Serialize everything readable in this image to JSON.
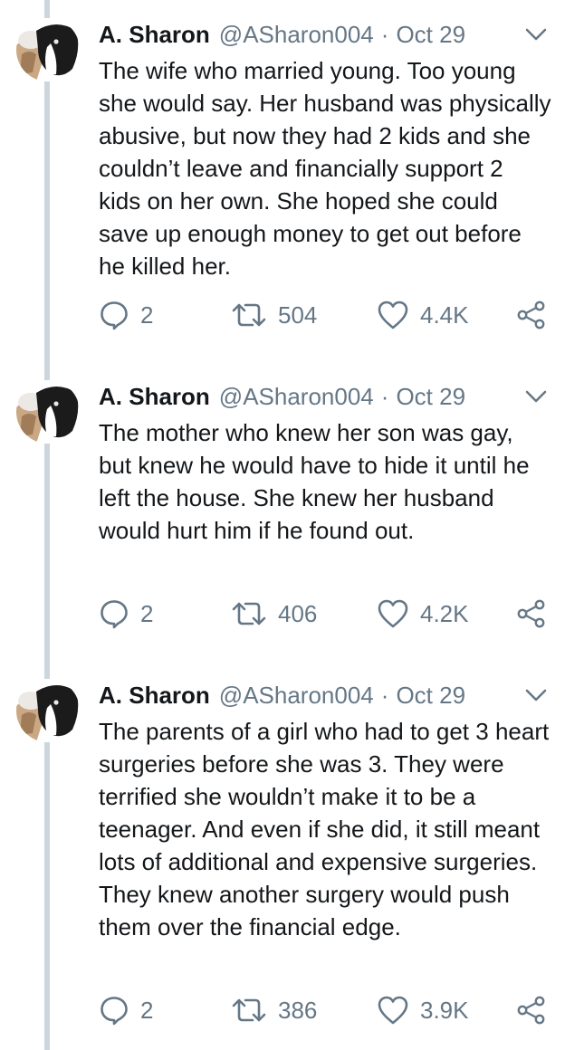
{
  "tweets": [
    {
      "author_name": "A. Sharon",
      "handle": "@ASharon004",
      "separator": "·",
      "date": "Oct 29",
      "text": "The wife who married young. Too young she would say. Her husband was physically abusive, but now they had 2 kids and she couldn’t leave and financially support 2 kids on her own. She hoped she could save up enough money to get out before he killed her.",
      "replies": "2",
      "retweets": "504",
      "likes": "4.4K"
    },
    {
      "author_name": "A. Sharon",
      "handle": "@ASharon004",
      "separator": "·",
      "date": "Oct 29",
      "text": "The mother who knew her son was gay, but knew he would have to hide it until he left the house. She knew her husband would hurt him if he found out.",
      "replies": "2",
      "retweets": "406",
      "likes": "4.2K"
    },
    {
      "author_name": "A. Sharon",
      "handle": "@ASharon004",
      "separator": "·",
      "date": "Oct 29",
      "text": "The parents of a girl who had to get 3 heart surgeries before she was 3. They were terrified she wouldn’t make it to be a teenager. And even if she did, it still meant lots of additional and expensive surgeries. They knew another surgery would push them over the financial edge.",
      "replies": "2",
      "retweets": "386",
      "likes": "3.9K"
    }
  ],
  "icons": {
    "reply": "speech-bubble-icon",
    "retweet": "retweet-arrows-icon",
    "like": "heart-icon",
    "share": "share-icon",
    "menu": "chevron-down-icon"
  },
  "colors": {
    "text": "#14171a",
    "secondary": "#657786",
    "thread_line": "#ccd6dd"
  }
}
